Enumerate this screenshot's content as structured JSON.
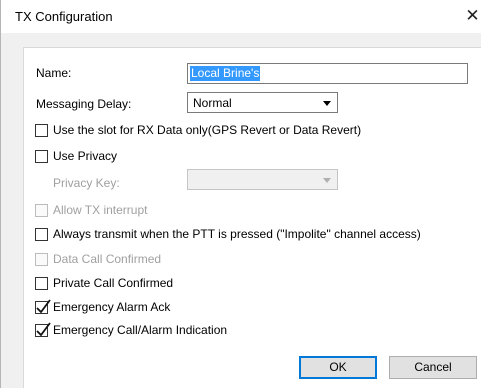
{
  "window": {
    "title": "TX Configuration",
    "close_icon": "close-icon"
  },
  "form": {
    "name_label": "Name:",
    "name_value": "Local Brine's",
    "messaging_delay_label": "Messaging Delay:",
    "messaging_delay_value": "Normal",
    "privacy_key_label": "Privacy Key:",
    "privacy_key_value": ""
  },
  "checkboxes": [
    {
      "label": "Use the slot for RX Data only(GPS Revert or Data Revert)",
      "checked": false,
      "enabled": true
    },
    {
      "label": "Use Privacy",
      "checked": false,
      "enabled": true
    },
    {
      "label": "Allow TX interrupt",
      "checked": false,
      "enabled": false
    },
    {
      "label": "Always transmit when the PTT is pressed (\"Impolite\" channel access)",
      "checked": false,
      "enabled": true
    },
    {
      "label": "Data Call Confirmed",
      "checked": false,
      "enabled": false
    },
    {
      "label": "Private Call Confirmed",
      "checked": false,
      "enabled": true
    },
    {
      "label": "Emergency Alarm Ack",
      "checked": true,
      "enabled": true
    },
    {
      "label": "Emergency Call/Alarm Indication",
      "checked": true,
      "enabled": true
    }
  ],
  "buttons": {
    "ok_label": "OK",
    "cancel_label": "Cancel"
  }
}
